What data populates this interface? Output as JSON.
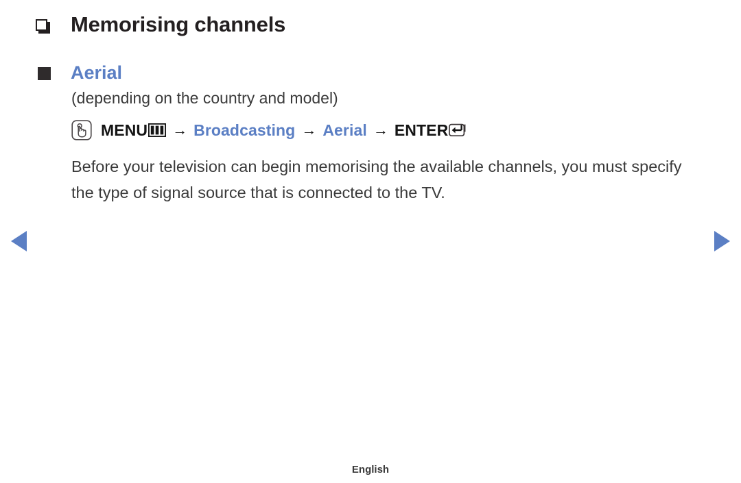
{
  "page": {
    "background_color": "#ffffff",
    "accent_blue": "#5b7fc4",
    "text_color": "#3a3a3a",
    "heading_color": "#231f20"
  },
  "chapter": {
    "bullet_icon": "hollow-square-bullet-icon",
    "title": "Memorising channels"
  },
  "section": {
    "bullet_icon": "solid-square-bullet-icon",
    "title": "Aerial",
    "note": "(depending on the country and model)"
  },
  "menu_path": {
    "touch_icon": "hand-press-icon",
    "steps": [
      {
        "label": "MENU",
        "color": "black",
        "trailing_icon": "menu-bars-icon"
      },
      {
        "label": "Broadcasting",
        "color": "blue",
        "trailing_icon": ""
      },
      {
        "label": "Aerial",
        "color": "blue",
        "trailing_icon": ""
      },
      {
        "label": "ENTER",
        "color": "black",
        "trailing_icon": "enter-key-icon"
      }
    ],
    "separator": "→"
  },
  "body": {
    "paragraph": "Before your television can begin memorising the available channels, you must specify the type of signal source that is connected to the TV."
  },
  "navigation": {
    "prev_icon": "triangle-left-icon",
    "next_icon": "triangle-right-icon",
    "arrow_color": "#5b7fc4"
  },
  "footer": {
    "language": "English"
  }
}
